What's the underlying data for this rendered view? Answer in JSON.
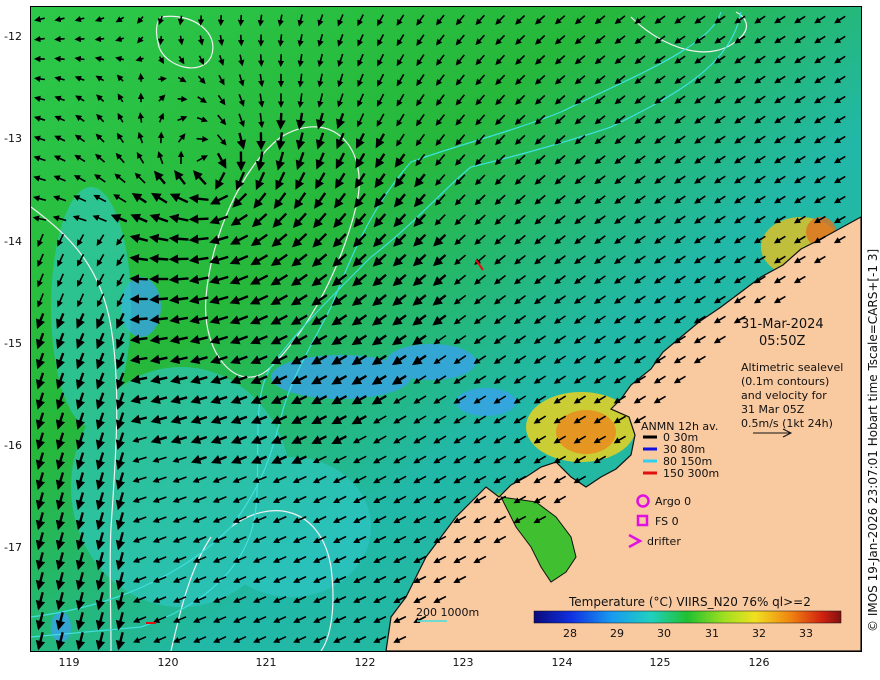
{
  "map": {
    "title_date": "31-Mar-2024",
    "title_time": "05:50Z",
    "description_lines": [
      "Altimetric sealevel",
      "(0.1m contours)",
      "and velocity for",
      "31 Mar 05Z",
      "0.5m/s (1kt 24h)"
    ],
    "y_ticks": [
      "-12",
      "-13",
      "-14",
      "-15",
      "-16",
      "-17"
    ],
    "x_ticks": [
      "119",
      "120",
      "121",
      "122",
      "123",
      "124",
      "125",
      "126"
    ],
    "side_caption": "© IMOS 19-Jan-2026 23:07:01 Hobart time Tscale=CARS+[-1 3]",
    "bathymetry_label": "200  1000m"
  },
  "legend": {
    "title": "ANMN 12h av.",
    "items": [
      {
        "label": "0 30m",
        "color": "#000000"
      },
      {
        "label": "30 80m",
        "color": "#1010e0"
      },
      {
        "label": "80 150m",
        "color": "#30d0f0"
      },
      {
        "label": "150 300m",
        "color": "#e01010"
      }
    ],
    "markers": [
      {
        "label": "Argo 0",
        "color": "#e010e0"
      },
      {
        "label": "FS 0",
        "color": "#e010e0"
      },
      {
        "label": "drifter",
        "color": "#e010e0"
      }
    ]
  },
  "colorbar": {
    "title": "Temperature (°C) VIIRS_N20 76% ql>=2",
    "ticks": [
      "28",
      "29",
      "30",
      "31",
      "32",
      "33"
    ]
  },
  "colors": {
    "land": "#f9c9a0",
    "ocean_green": "#22c020",
    "ocean_cyan": "#20c0a0",
    "ocean_blue": "#3098f0",
    "warm_orange": "#e89020"
  }
}
